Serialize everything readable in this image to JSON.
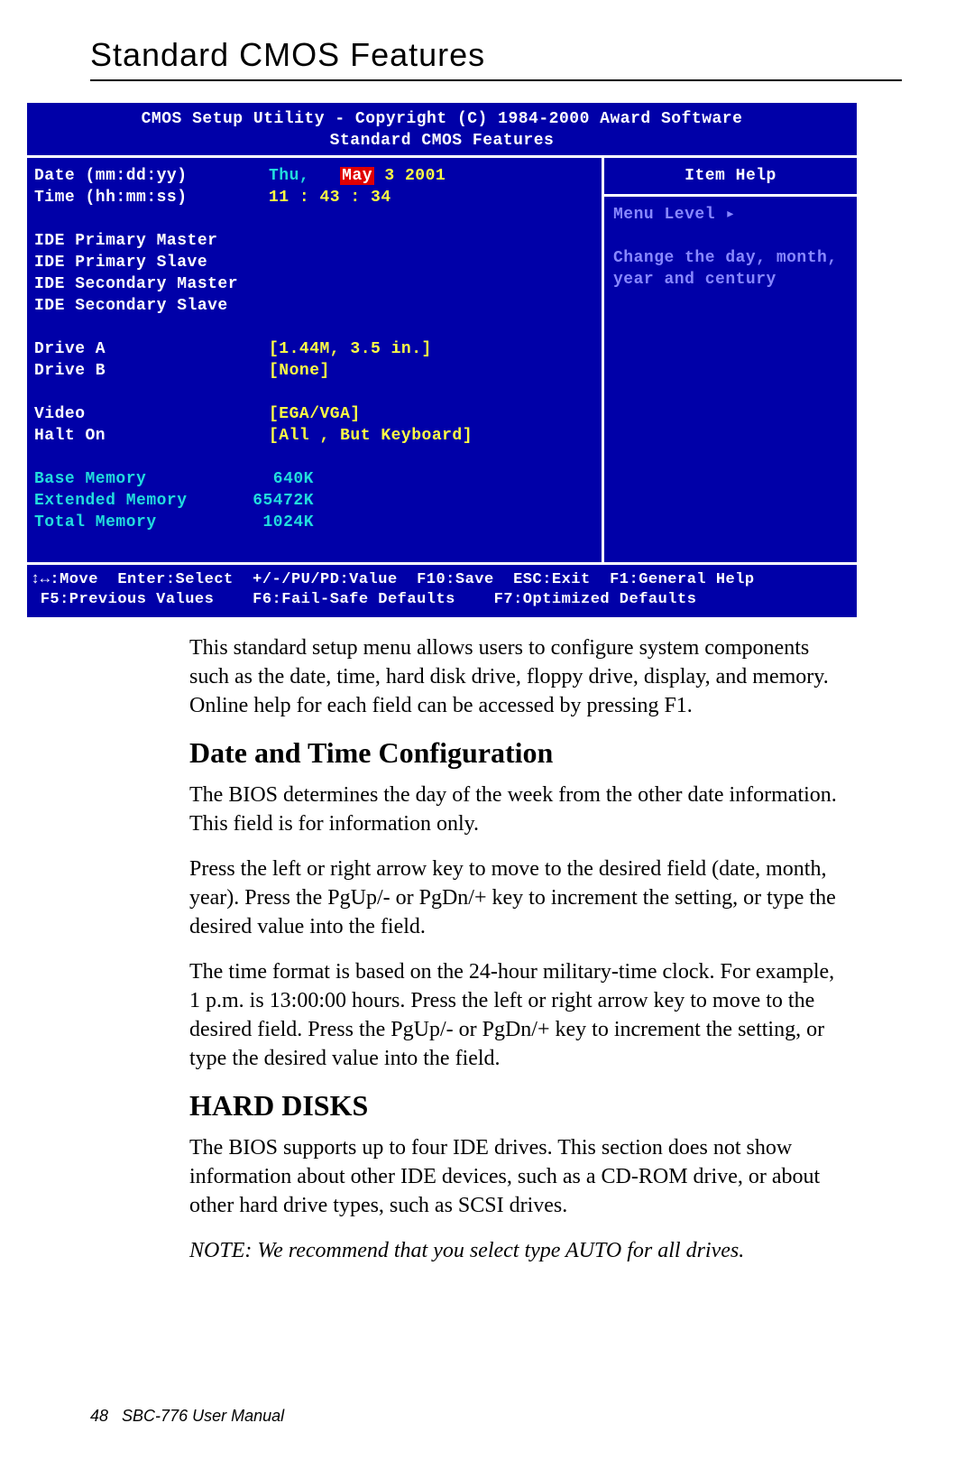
{
  "page": {
    "title": "Standard CMOS Features",
    "number": "48",
    "product": "SBC-776 User Manual"
  },
  "bios": {
    "header_line1": "CMOS Setup Utility - Copyright (C) 1984-2000 Award Software",
    "header_line2": "Standard CMOS Features",
    "fields": {
      "date_label": "Date (mm:dd:yy)",
      "date_day": "Thu,",
      "date_month": "May",
      "date_rest": "  3 2001",
      "time_label": "Time (hh:mm:ss)",
      "time_value": "11 : 43 : 34",
      "ide_pm": "IDE Primary Master",
      "ide_ps": "IDE Primary Slave",
      "ide_sm": "IDE Secondary Master",
      "ide_ss": "IDE Secondary Slave",
      "drive_a_label": "Drive A",
      "drive_a_value": "[1.44M, 3.5 in.]",
      "drive_b_label": "Drive B",
      "drive_b_value": "[None]",
      "video_label": "Video",
      "video_value": "[EGA/VGA]",
      "halt_label": "Halt On",
      "halt_value": "[All , But Keyboard]",
      "base_mem_label": "Base Memory",
      "base_mem_value": "640K",
      "ext_mem_label": "Extended Memory",
      "ext_mem_value": "65472K",
      "total_mem_label": "Total Memory",
      "total_mem_value": "1024K"
    },
    "help": {
      "title": "Item Help",
      "menu_level": "Menu Level   ▸",
      "hint_line1": "Change the day, month,",
      "hint_line2": "year and century"
    },
    "footer": {
      "line1": "↕↔:Move  Enter:Select  +/-/PU/PD:Value  F10:Save  ESC:Exit  F1:General Help",
      "line2": " F5:Previous Values    F6:Fail-Safe Defaults    F7:Optimized Defaults"
    }
  },
  "doc": {
    "intro": "This standard setup menu allows users to configure system components such as the date, time, hard disk drive, floppy drive, display, and memory.  Online help for each field can be accessed by pressing F1.",
    "sections": [
      {
        "heading": "Date and Time Configuration",
        "paragraphs": [
          "The BIOS determines the day of the week from the other date information. This field is for information only.",
          "Press the left or right arrow key to move to the desired field (date, month, year). Press the PgUp/- or PgDn/+ key to increment the setting, or type the desired value into the field.",
          "The time format is based on the 24-hour military-time clock. For example, 1 p.m. is 13:00:00 hours. Press the left or right arrow key to move to the desired field. Press the PgUp/- or PgDn/+ key to increment the setting, or type the desired value into the field."
        ]
      },
      {
        "heading": "HARD DISKS",
        "paragraphs": [
          "The BIOS supports up to four IDE drives. This section does not show information about other IDE devices, such as a CD-ROM drive, or about other hard drive types, such as SCSI drives."
        ]
      }
    ],
    "note": "NOTE: We recommend that you select type AUTO for all drives."
  }
}
